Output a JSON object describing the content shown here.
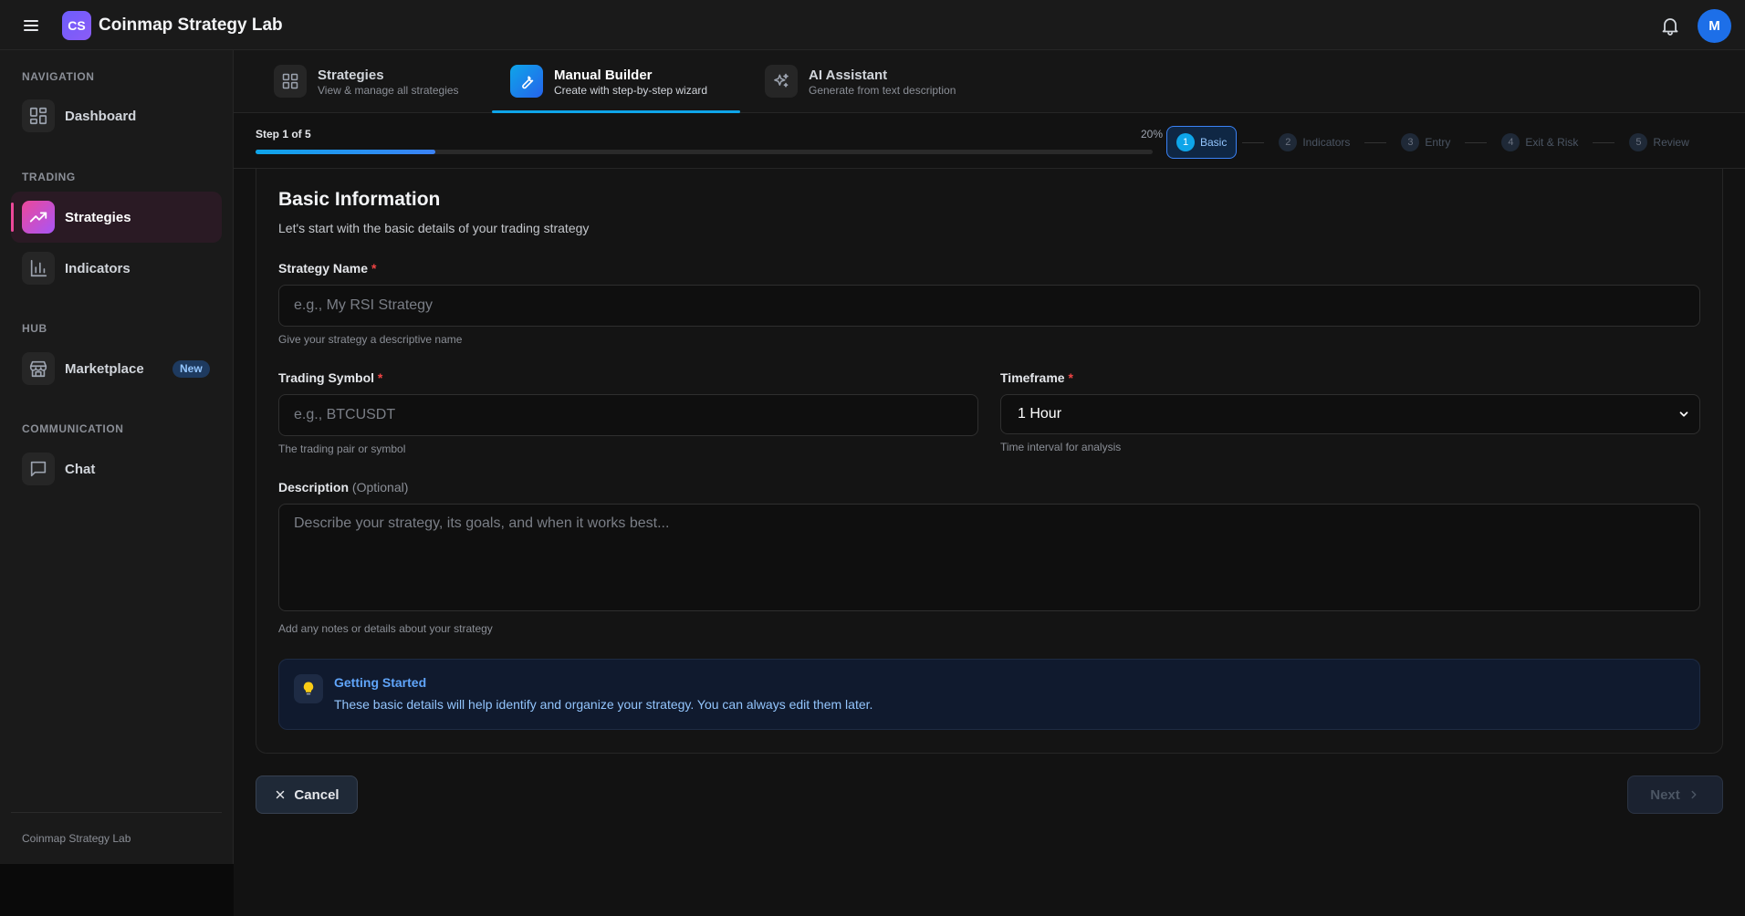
{
  "app": {
    "logo_text": "CS",
    "title": "Coinmap Strategy Lab",
    "avatar_initial": "M"
  },
  "sidebar": {
    "sections": [
      {
        "label": "NAVIGATION"
      },
      {
        "label": "TRADING"
      },
      {
        "label": "HUB"
      },
      {
        "label": "COMMUNICATION"
      }
    ],
    "items": [
      {
        "label": "Dashboard",
        "icon": "dashboard-icon"
      },
      {
        "label": "Strategies",
        "icon": "trending-up-icon",
        "active": true
      },
      {
        "label": "Indicators",
        "icon": "bar-chart-icon"
      },
      {
        "label": "Marketplace",
        "icon": "store-icon",
        "badge": "New"
      },
      {
        "label": "Chat",
        "icon": "chat-icon"
      }
    ],
    "footer": "Coinmap Strategy Lab"
  },
  "tabs": [
    {
      "title": "Strategies",
      "subtitle": "View & manage all strategies",
      "icon": "grid-icon"
    },
    {
      "title": "Manual Builder",
      "subtitle": "Create with step-by-step wizard",
      "icon": "wrench-icon",
      "active": true
    },
    {
      "title": "AI Assistant",
      "subtitle": "Generate from text description",
      "icon": "sparkles-icon"
    }
  ],
  "progress": {
    "step_text": "Step 1 of 5",
    "percent_text": "20%",
    "percent": 0.2
  },
  "stepper": [
    {
      "num": "1",
      "label": "Basic",
      "active": true
    },
    {
      "num": "2",
      "label": "Indicators"
    },
    {
      "num": "3",
      "label": "Entry"
    },
    {
      "num": "4",
      "label": "Exit & Risk"
    },
    {
      "num": "5",
      "label": "Review"
    }
  ],
  "form": {
    "title": "Basic Information",
    "subtitle": "Let's start with the basic details of your trading strategy",
    "strategy_name": {
      "label": "Strategy Name",
      "required_mark": "*",
      "placeholder": "e.g., My RSI Strategy",
      "value": "",
      "help": "Give your strategy a descriptive name"
    },
    "trading_symbol": {
      "label": "Trading Symbol",
      "required_mark": "*",
      "placeholder": "e.g., BTCUSDT",
      "value": "",
      "help": "The trading pair or symbol"
    },
    "timeframe": {
      "label": "Timeframe",
      "required_mark": "*",
      "selected": "1 Hour",
      "help": "Time interval for analysis"
    },
    "description": {
      "label": "Description",
      "optional_text": "(Optional)",
      "placeholder": "Describe your strategy, its goals, and when it works best...",
      "value": "",
      "help": "Add any notes or details about your strategy"
    },
    "tip": {
      "title": "Getting Started",
      "text": "These basic details will help identify and organize your strategy. You can always edit them later."
    }
  },
  "actions": {
    "cancel_label": "Cancel",
    "next_label": "Next"
  },
  "colors": {
    "accent": "#0ea5e9",
    "active_nav": "#ec4899",
    "required": "#ef4444",
    "background": "#121212"
  }
}
